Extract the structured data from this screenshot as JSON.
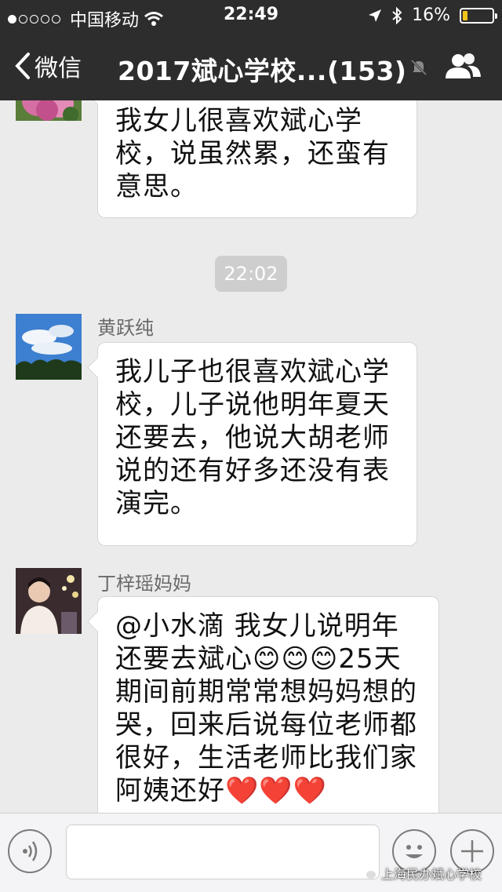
{
  "status_bar": {
    "carrier": "中国移动",
    "time": "22:49",
    "battery": "16%",
    "battery_level": 0.16,
    "signal_bars_filled": 1
  },
  "nav": {
    "back_label": "微信",
    "title": "2017斌心学校...(153)"
  },
  "messages": [
    {
      "type": "text",
      "sender": "",
      "text": "我女儿很喜欢斌心学校，说虽然累，还蛮有意思。"
    },
    {
      "type": "timestamp",
      "text": "22:02"
    },
    {
      "type": "text",
      "sender": "黄跃纯",
      "text": "我儿子也很喜欢斌心学校，儿子说他明年夏天还要去，他说大胡老师说的还有好多还没有表演完。"
    },
    {
      "type": "text",
      "sender": "丁梓瑶妈妈",
      "text": "@小水滴 我女儿说明年还要去斌心😊😊😊25天期间前期常常想妈妈想的哭，回来后说每位老师都很好，生活老师比我们家阿姨还好❤️❤️❤️"
    }
  ],
  "watermark": "上海民办斌心学校",
  "colors": {
    "header_bg": "#2d2d2d",
    "chat_bg": "#ebebeb",
    "battery_fill": "#f0c419"
  }
}
